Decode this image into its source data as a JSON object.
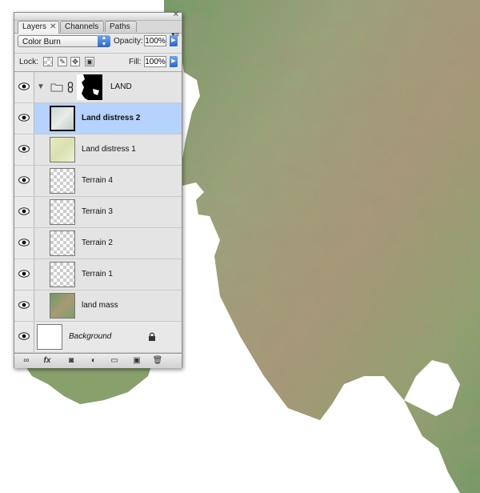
{
  "panel": {
    "tabs": [
      {
        "label": "Layers",
        "close": "✕"
      },
      {
        "label": "Channels"
      },
      {
        "label": "Paths"
      }
    ],
    "blend_mode": "Color Burn",
    "opacity_label": "Opacity:",
    "opacity_value": "100%",
    "lock_label": "Lock:",
    "fill_label": "Fill:",
    "fill_value": "100%",
    "group": {
      "name": "LAND",
      "icon": "folder-icon",
      "mask_icon": "layer-mask-icon"
    },
    "layers": [
      {
        "name": "Land distress 2",
        "selected": true
      },
      {
        "name": "Land distress 1",
        "selected": false
      },
      {
        "name": "Terrain 4",
        "selected": false
      },
      {
        "name": "Terrain 3",
        "selected": false
      },
      {
        "name": "Terrain 2",
        "selected": false
      },
      {
        "name": "Terrain 1",
        "selected": false
      },
      {
        "name": "land mass",
        "selected": false
      }
    ],
    "background": {
      "name": "Background",
      "locked": true
    },
    "bottom_icons": [
      "link-icon",
      "fx-icon",
      "mask-icon",
      "adjustment-icon",
      "new-group-icon",
      "new-layer-icon",
      "trash-icon"
    ],
    "fx_label": "fx"
  },
  "colors": {
    "selection": "#b5d3fd",
    "accent": "#2c67c9"
  }
}
